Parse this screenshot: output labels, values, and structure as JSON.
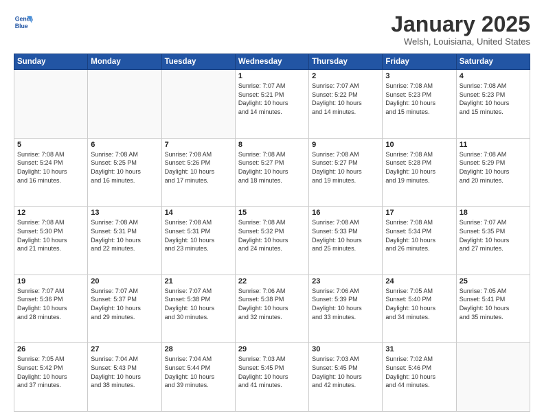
{
  "header": {
    "logo_line1": "General",
    "logo_line2": "Blue",
    "month": "January 2025",
    "location": "Welsh, Louisiana, United States"
  },
  "weekdays": [
    "Sunday",
    "Monday",
    "Tuesday",
    "Wednesday",
    "Thursday",
    "Friday",
    "Saturday"
  ],
  "weeks": [
    [
      {
        "day": "",
        "info": ""
      },
      {
        "day": "",
        "info": ""
      },
      {
        "day": "",
        "info": ""
      },
      {
        "day": "1",
        "info": "Sunrise: 7:07 AM\nSunset: 5:21 PM\nDaylight: 10 hours\nand 14 minutes."
      },
      {
        "day": "2",
        "info": "Sunrise: 7:07 AM\nSunset: 5:22 PM\nDaylight: 10 hours\nand 14 minutes."
      },
      {
        "day": "3",
        "info": "Sunrise: 7:08 AM\nSunset: 5:23 PM\nDaylight: 10 hours\nand 15 minutes."
      },
      {
        "day": "4",
        "info": "Sunrise: 7:08 AM\nSunset: 5:23 PM\nDaylight: 10 hours\nand 15 minutes."
      }
    ],
    [
      {
        "day": "5",
        "info": "Sunrise: 7:08 AM\nSunset: 5:24 PM\nDaylight: 10 hours\nand 16 minutes."
      },
      {
        "day": "6",
        "info": "Sunrise: 7:08 AM\nSunset: 5:25 PM\nDaylight: 10 hours\nand 16 minutes."
      },
      {
        "day": "7",
        "info": "Sunrise: 7:08 AM\nSunset: 5:26 PM\nDaylight: 10 hours\nand 17 minutes."
      },
      {
        "day": "8",
        "info": "Sunrise: 7:08 AM\nSunset: 5:27 PM\nDaylight: 10 hours\nand 18 minutes."
      },
      {
        "day": "9",
        "info": "Sunrise: 7:08 AM\nSunset: 5:27 PM\nDaylight: 10 hours\nand 19 minutes."
      },
      {
        "day": "10",
        "info": "Sunrise: 7:08 AM\nSunset: 5:28 PM\nDaylight: 10 hours\nand 19 minutes."
      },
      {
        "day": "11",
        "info": "Sunrise: 7:08 AM\nSunset: 5:29 PM\nDaylight: 10 hours\nand 20 minutes."
      }
    ],
    [
      {
        "day": "12",
        "info": "Sunrise: 7:08 AM\nSunset: 5:30 PM\nDaylight: 10 hours\nand 21 minutes."
      },
      {
        "day": "13",
        "info": "Sunrise: 7:08 AM\nSunset: 5:31 PM\nDaylight: 10 hours\nand 22 minutes."
      },
      {
        "day": "14",
        "info": "Sunrise: 7:08 AM\nSunset: 5:31 PM\nDaylight: 10 hours\nand 23 minutes."
      },
      {
        "day": "15",
        "info": "Sunrise: 7:08 AM\nSunset: 5:32 PM\nDaylight: 10 hours\nand 24 minutes."
      },
      {
        "day": "16",
        "info": "Sunrise: 7:08 AM\nSunset: 5:33 PM\nDaylight: 10 hours\nand 25 minutes."
      },
      {
        "day": "17",
        "info": "Sunrise: 7:08 AM\nSunset: 5:34 PM\nDaylight: 10 hours\nand 26 minutes."
      },
      {
        "day": "18",
        "info": "Sunrise: 7:07 AM\nSunset: 5:35 PM\nDaylight: 10 hours\nand 27 minutes."
      }
    ],
    [
      {
        "day": "19",
        "info": "Sunrise: 7:07 AM\nSunset: 5:36 PM\nDaylight: 10 hours\nand 28 minutes."
      },
      {
        "day": "20",
        "info": "Sunrise: 7:07 AM\nSunset: 5:37 PM\nDaylight: 10 hours\nand 29 minutes."
      },
      {
        "day": "21",
        "info": "Sunrise: 7:07 AM\nSunset: 5:38 PM\nDaylight: 10 hours\nand 30 minutes."
      },
      {
        "day": "22",
        "info": "Sunrise: 7:06 AM\nSunset: 5:38 PM\nDaylight: 10 hours\nand 32 minutes."
      },
      {
        "day": "23",
        "info": "Sunrise: 7:06 AM\nSunset: 5:39 PM\nDaylight: 10 hours\nand 33 minutes."
      },
      {
        "day": "24",
        "info": "Sunrise: 7:05 AM\nSunset: 5:40 PM\nDaylight: 10 hours\nand 34 minutes."
      },
      {
        "day": "25",
        "info": "Sunrise: 7:05 AM\nSunset: 5:41 PM\nDaylight: 10 hours\nand 35 minutes."
      }
    ],
    [
      {
        "day": "26",
        "info": "Sunrise: 7:05 AM\nSunset: 5:42 PM\nDaylight: 10 hours\nand 37 minutes."
      },
      {
        "day": "27",
        "info": "Sunrise: 7:04 AM\nSunset: 5:43 PM\nDaylight: 10 hours\nand 38 minutes."
      },
      {
        "day": "28",
        "info": "Sunrise: 7:04 AM\nSunset: 5:44 PM\nDaylight: 10 hours\nand 39 minutes."
      },
      {
        "day": "29",
        "info": "Sunrise: 7:03 AM\nSunset: 5:45 PM\nDaylight: 10 hours\nand 41 minutes."
      },
      {
        "day": "30",
        "info": "Sunrise: 7:03 AM\nSunset: 5:45 PM\nDaylight: 10 hours\nand 42 minutes."
      },
      {
        "day": "31",
        "info": "Sunrise: 7:02 AM\nSunset: 5:46 PM\nDaylight: 10 hours\nand 44 minutes."
      },
      {
        "day": "",
        "info": ""
      }
    ]
  ]
}
